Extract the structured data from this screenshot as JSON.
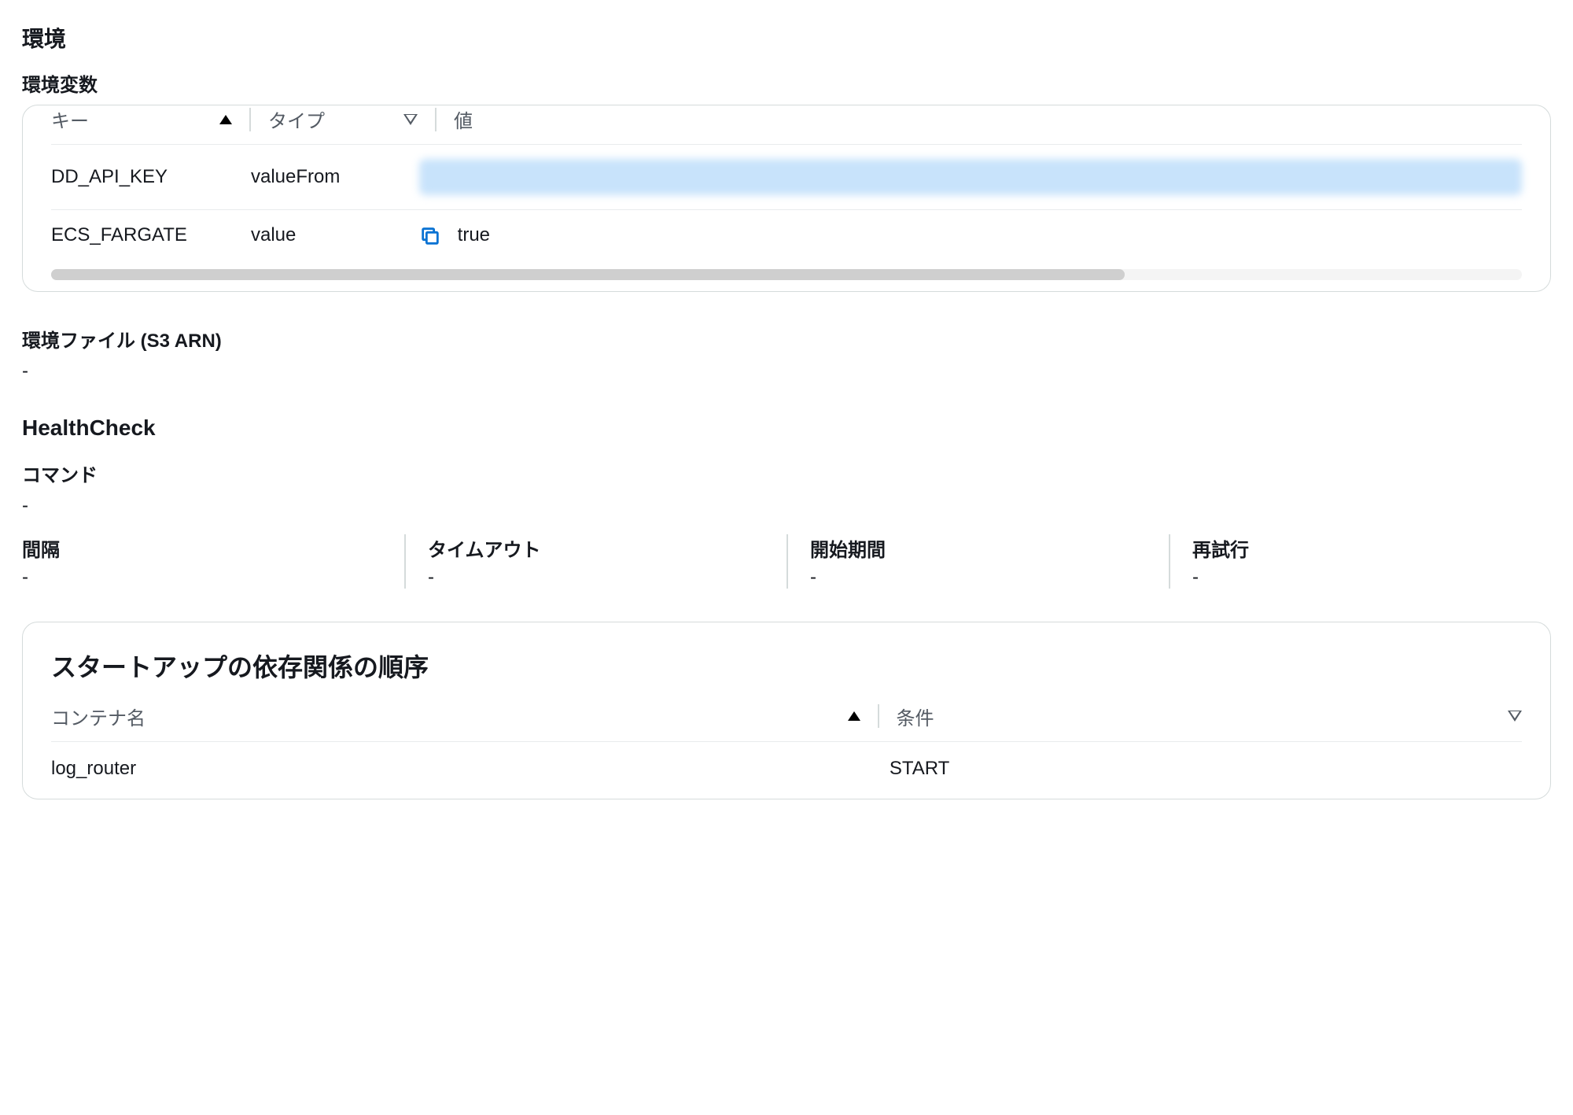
{
  "environment": {
    "title": "環境",
    "env_vars_label": "環境変数",
    "columns": {
      "key": "キー",
      "type": "タイプ",
      "value": "値"
    },
    "rows": [
      {
        "key": "DD_API_KEY",
        "type": "valueFrom",
        "value_redacted": true,
        "value": ""
      },
      {
        "key": "ECS_FARGATE",
        "type": "value",
        "value_redacted": false,
        "value": "true"
      }
    ]
  },
  "env_file": {
    "label": "環境ファイル (S3 ARN)",
    "value": "-"
  },
  "healthcheck": {
    "title": "HealthCheck",
    "command_label": "コマンド",
    "command_value": "-",
    "items": [
      {
        "label": "間隔",
        "value": "-"
      },
      {
        "label": "タイムアウト",
        "value": "-"
      },
      {
        "label": "開始期間",
        "value": "-"
      },
      {
        "label": "再試行",
        "value": "-"
      }
    ]
  },
  "startup": {
    "title": "スタートアップの依存関係の順序",
    "columns": {
      "container": "コンテナ名",
      "condition": "条件"
    },
    "rows": [
      {
        "container": "log_router",
        "condition": "START"
      }
    ]
  }
}
